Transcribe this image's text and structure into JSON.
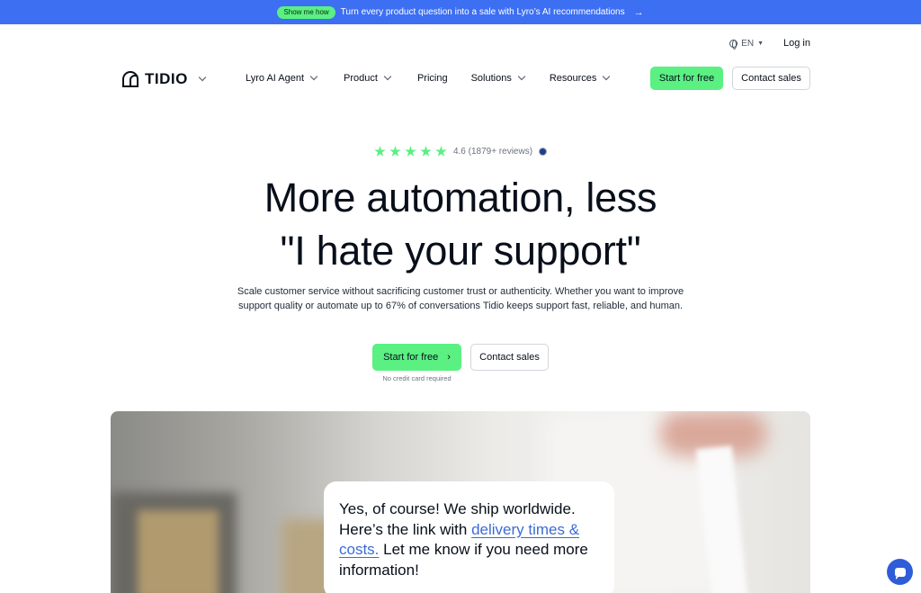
{
  "promo": {
    "badge": "Show me how",
    "text": "Turn every product question into a sale with Lyro’s AI recommendations",
    "arrow": "→"
  },
  "util": {
    "language": "EN",
    "login": "Log in"
  },
  "nav": {
    "logo_text": "TIDIO",
    "items": [
      {
        "label": "Lyro AI Agent",
        "has_dropdown": true
      },
      {
        "label": "Product",
        "has_dropdown": true
      },
      {
        "label": "Pricing",
        "has_dropdown": false
      },
      {
        "label": "Solutions",
        "has_dropdown": true
      },
      {
        "label": "Resources",
        "has_dropdown": true
      }
    ],
    "start_label": "Start for free",
    "contact_label": "Contact sales"
  },
  "hero": {
    "rating_text": "4.6 (1879+ reviews)",
    "stars": 5,
    "headline_line1": "More automation, less",
    "headline_line2": "\"I hate your support\"",
    "sub_line1": "Scale customer service without sacrificing customer trust or authenticity. Whether you want to improve",
    "sub_line2": "support quality or automate up to 67% of conversations Tidio keeps support fast, reliable, and human.",
    "cta_start": "Start for free",
    "cta_contact": "Contact sales",
    "no_card": "No credit card required"
  },
  "bubble": {
    "text_before": "Yes, of course! We ship worldwide. Here’s the link with ",
    "link_text": "delivery times & costs.",
    "text_after": " Let me know if you need more information!"
  },
  "colors": {
    "promo_bg": "#3d6ff2",
    "accent_green": "#5af082",
    "link_blue": "#3b6bd8",
    "launcher_blue": "#2f5dd8"
  }
}
